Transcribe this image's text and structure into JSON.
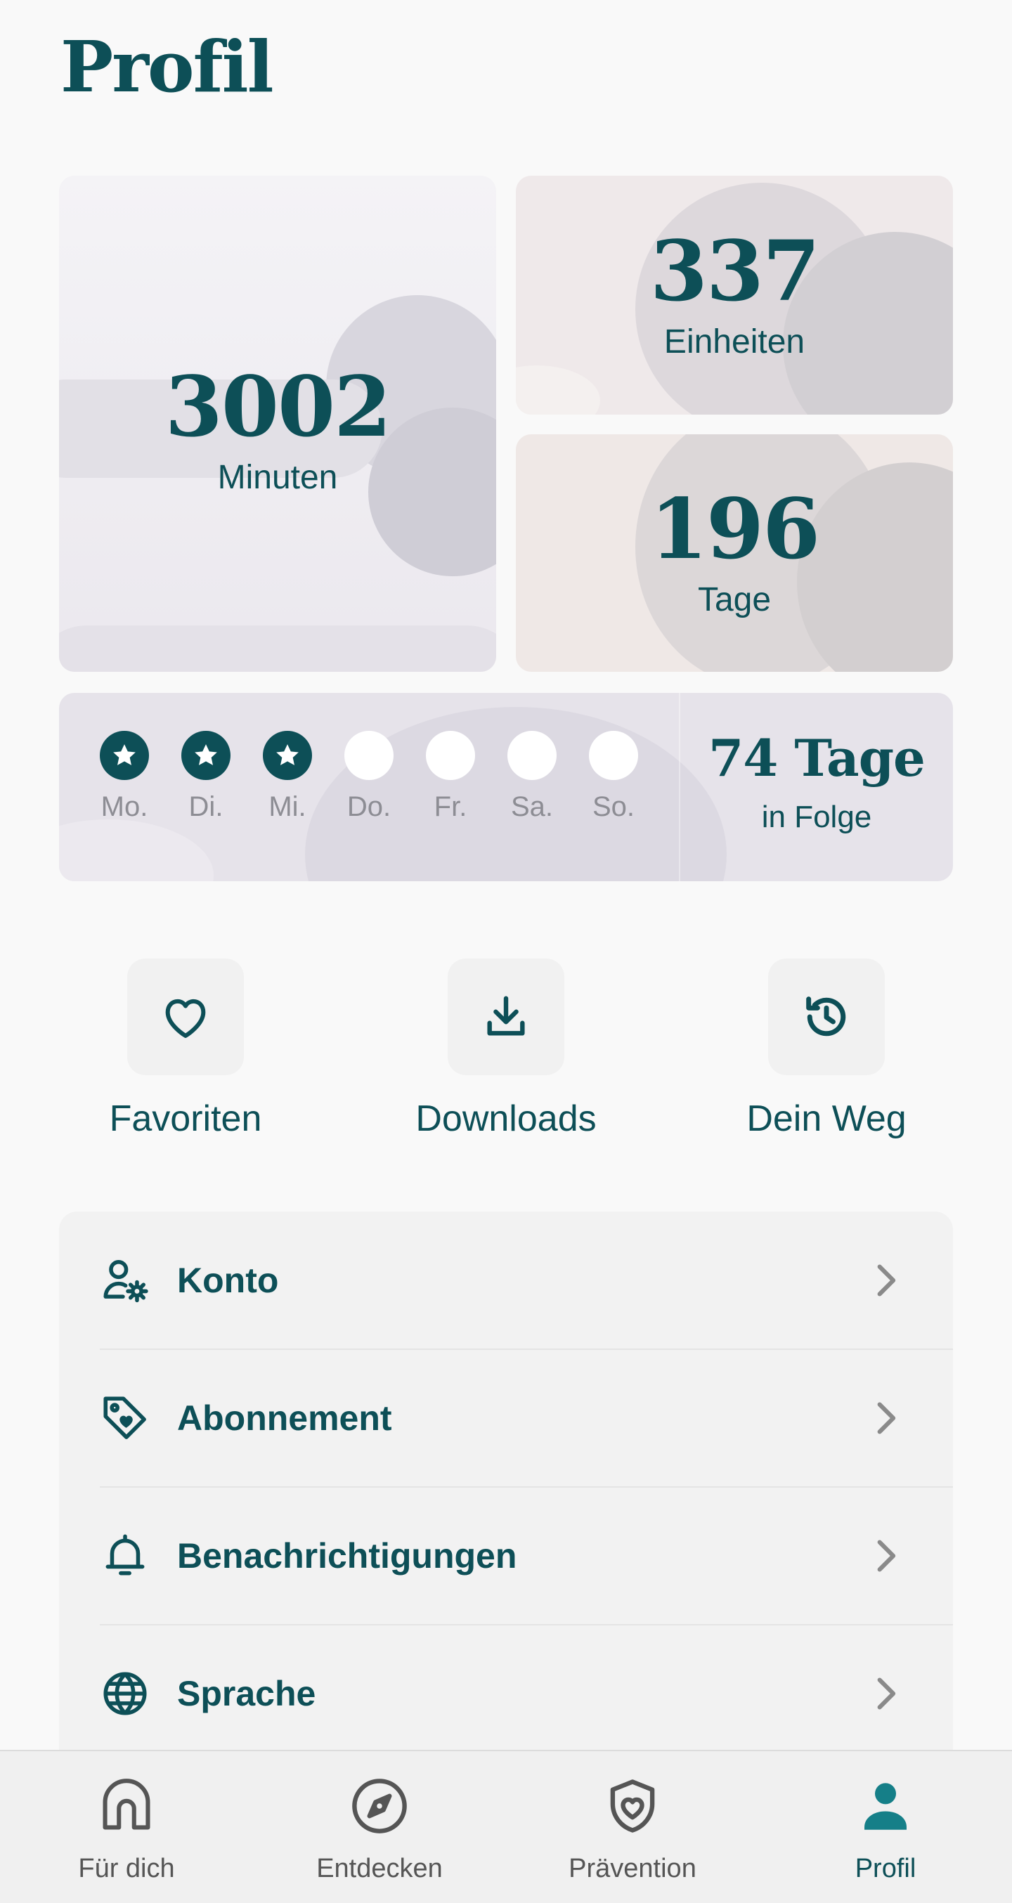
{
  "header": {
    "title": "Profil"
  },
  "stats": {
    "minutes": {
      "value": "3002",
      "label": "Minuten"
    },
    "units": {
      "value": "337",
      "label": "Einheiten"
    },
    "days": {
      "value": "196",
      "label": "Tage"
    }
  },
  "streak": {
    "days": [
      {
        "label": "Mo.",
        "done": true
      },
      {
        "label": "Di.",
        "done": true
      },
      {
        "label": "Mi.",
        "done": true
      },
      {
        "label": "Do.",
        "done": false
      },
      {
        "label": "Fr.",
        "done": false
      },
      {
        "label": "Sa.",
        "done": false
      },
      {
        "label": "So.",
        "done": false
      }
    ],
    "count": "74 Tage",
    "sub": "in Folge"
  },
  "quick_actions": [
    {
      "label": "Favoriten",
      "icon": "heart-icon"
    },
    {
      "label": "Downloads",
      "icon": "download-icon"
    },
    {
      "label": "Dein Weg",
      "icon": "history-icon"
    }
  ],
  "menu": [
    {
      "label": "Konto",
      "icon": "user-settings-icon"
    },
    {
      "label": "Abonnement",
      "icon": "tag-heart-icon"
    },
    {
      "label": "Benachrichtigungen",
      "icon": "bell-icon"
    },
    {
      "label": "Sprache",
      "icon": "globe-icon"
    }
  ],
  "nav": [
    {
      "label": "Für dich",
      "icon": "home-icon",
      "active": false
    },
    {
      "label": "Entdecken",
      "icon": "compass-icon",
      "active": false
    },
    {
      "label": "Prävention",
      "icon": "shield-heart-icon",
      "active": false
    },
    {
      "label": "Profil",
      "icon": "person-icon",
      "active": true
    }
  ],
  "colors": {
    "primary": "#0d4f57",
    "active_nav": "#157f88",
    "muted": "#8d8d94"
  }
}
